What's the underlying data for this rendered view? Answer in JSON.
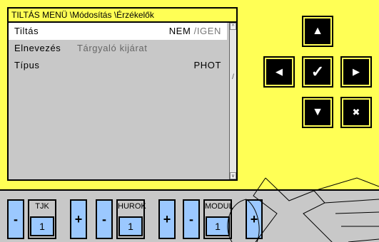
{
  "panel": {
    "title": "TILTÁS MENÜ \\Módosítás \\Érzékelők",
    "rows": [
      {
        "label": "Tiltás",
        "value": "NEM",
        "value_alt": " /IGEN",
        "selected": true
      },
      {
        "label": "Elnevezés",
        "value_inline": "Tárgyaló kijárat"
      },
      {
        "label": "Típus",
        "value": "PHOT"
      }
    ],
    "scroll_up": "^",
    "scroll_down": "v",
    "scroll_grip": "/"
  },
  "nav": {
    "up": "▲",
    "left": "◀",
    "ok": "✓",
    "right": "▶",
    "down": "▼",
    "cancel": "✖"
  },
  "bottom": {
    "groups": [
      {
        "label": "TJK",
        "value": "1",
        "minus": "-",
        "plus": "+"
      },
      {
        "label": "HUROK",
        "value": "1",
        "minus": "-",
        "plus": "+"
      },
      {
        "label": "MODUL",
        "value": "1",
        "minus": "-",
        "plus": "+"
      }
    ]
  },
  "colors": {
    "background": "#ffff55",
    "panel": "#c8c8c8",
    "button": "#9bc8ff",
    "nav_button": "#000000"
  }
}
